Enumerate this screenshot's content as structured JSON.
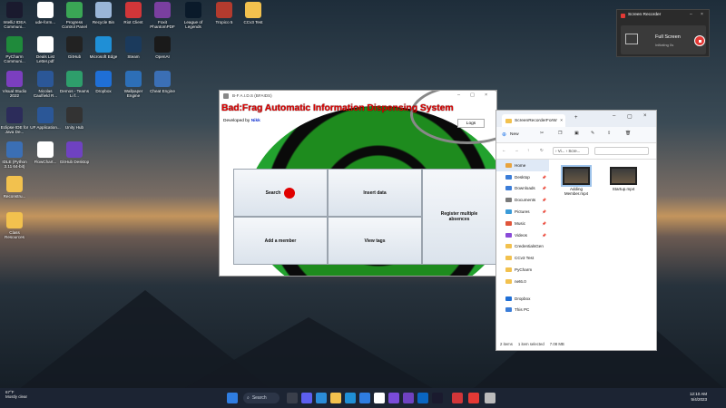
{
  "desktop": {
    "icons": [
      {
        "label": "IntelliJ IDEA Communi...",
        "color": "#1a1a2e"
      },
      {
        "label": "PyCharm Communi...",
        "color": "#1f8a3b"
      },
      {
        "label": "Visual Studio 2022",
        "color": "#7b3fbf"
      },
      {
        "label": "Eclipse IDE for Java De...",
        "color": "#2c2c5a"
      },
      {
        "label": "IDLE (Python 3.11 64-bit)",
        "color": "#3b6fb5"
      },
      {
        "label": "Reconstru...",
        "color": "#f2c14e"
      },
      {
        "label": "Class Resources",
        "color": "#f2c14e"
      },
      {
        "label": "ude-form...",
        "color": "#ffffff"
      },
      {
        "label": "Deals List Letter.pdf",
        "color": "#ffffff"
      },
      {
        "label": "Nicolas Caulfield R...",
        "color": "#2b5797"
      },
      {
        "label": "UF Application...",
        "color": "#2b5797"
      },
      {
        "label": "FlowChart...",
        "color": "#ffffff"
      },
      {
        "label": "Progress Control Panel",
        "color": "#3aa655"
      },
      {
        "label": "GitHub",
        "color": "#222222"
      },
      {
        "label": "Demos - Teams Li f...",
        "color": "#2e9e6b"
      },
      {
        "label": "Unity Hub",
        "color": "#333333"
      },
      {
        "label": "GitHub Desktop",
        "color": "#6f42c1"
      },
      {
        "label": "Recycle Bin",
        "color": "#9ab6d8"
      },
      {
        "label": "Microsoft Edge",
        "color": "#1f8fd6"
      },
      {
        "label": "Dropbox",
        "color": "#1f6fd6"
      },
      {
        "label": "Riot Client",
        "color": "#d13639"
      },
      {
        "label": "Steam",
        "color": "#1b3a5c"
      },
      {
        "label": "Wallpaper Engine",
        "color": "#2d6fb7"
      },
      {
        "label": "Foxit PhantomPDF",
        "color": "#7a3fa0"
      },
      {
        "label": "OpenAI",
        "color": "#1a1a1a"
      },
      {
        "label": "Cheat Engine",
        "color": "#3b6fb5"
      },
      {
        "label": "League of Legends",
        "color": "#0a1a2a"
      },
      {
        "label": "Tropico 5",
        "color": "#b33b2e"
      },
      {
        "label": "CCv3 Test",
        "color": "#f2c14e"
      }
    ]
  },
  "recorder": {
    "title": "Screen Recorder",
    "mode": "Full Screen",
    "status": "Initiating",
    "status2": "0s"
  },
  "app": {
    "window_title": "B-F A.I.D.S (BFAIDS)",
    "heading": "Bad:Frag Automatic Information Dispensing System",
    "developer_label": "Developed by",
    "developer_name": "Nikk",
    "logs_label": "Logs",
    "buttons": {
      "search": "Search",
      "insert": "Insert data",
      "register": "Register multiple absences",
      "add_member": "Add a member",
      "view_tags": "View tags"
    }
  },
  "explorer": {
    "tab_title": "ScreenRecorderForW",
    "new_label": "New",
    "address": [
      "Vi...",
      "Scre..."
    ],
    "sidebar": [
      {
        "label": "Home",
        "selected": true,
        "color": "#e8a33d"
      },
      {
        "label": "Desktop",
        "color": "#3b7dd8"
      },
      {
        "label": "Downloads",
        "color": "#3b7dd8"
      },
      {
        "label": "Documents",
        "color": "#7a7a7a"
      },
      {
        "label": "Pictures",
        "color": "#3b9bd8"
      },
      {
        "label": "Music",
        "color": "#e0553a"
      },
      {
        "label": "Videos",
        "color": "#8a4bd8"
      },
      {
        "label": "CredentialsGen",
        "color": "#f2c14e"
      },
      {
        "label": "CCv3 Test",
        "color": "#f2c14e"
      },
      {
        "label": "PyCharm",
        "color": "#f2c14e"
      },
      {
        "label": "net6.0",
        "color": "#f2c14e"
      },
      {
        "label": "Dropbox",
        "color": "#1f6fd6"
      },
      {
        "label": "This PC",
        "color": "#3b7dd8"
      }
    ],
    "files": [
      {
        "name": "Adding Member.mp4",
        "selected": true
      },
      {
        "name": "Startup.mp4",
        "selected": false
      }
    ],
    "status": {
      "items": "2 items",
      "selected": "1 item selected",
      "size": "7.08 MB"
    }
  },
  "taskbar": {
    "search_label": "Search",
    "weather_temp": "67°F",
    "weather_desc": "Mostly clear",
    "time": "12:10 AM",
    "date": "5/4/2023"
  }
}
